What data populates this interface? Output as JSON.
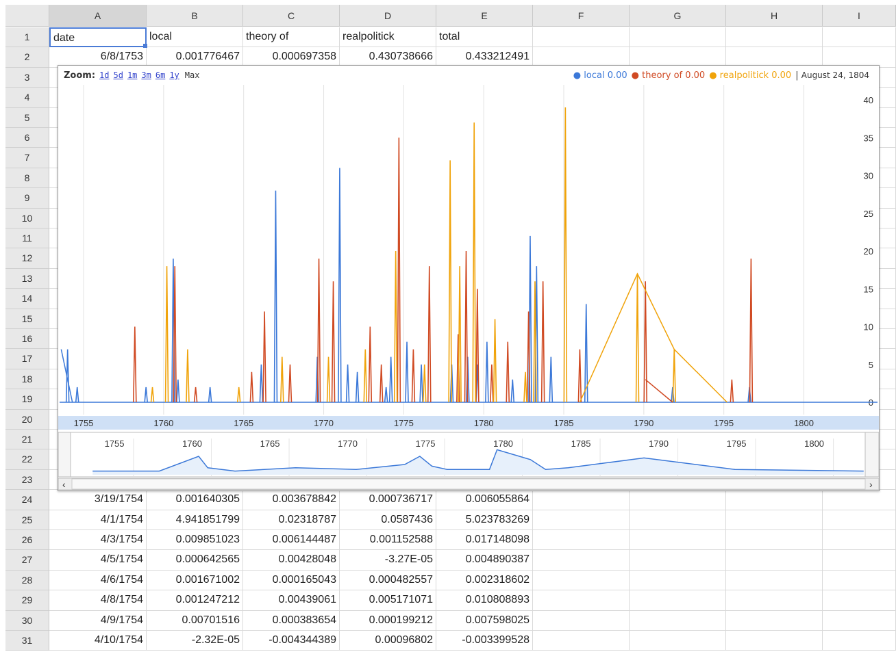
{
  "columns": [
    "A",
    "B",
    "C",
    "D",
    "E",
    "F",
    "G",
    "H",
    "I"
  ],
  "rows": [
    {
      "num": "1",
      "cells": [
        "date",
        "local",
        "theory of",
        "realpolitick",
        "total"
      ]
    },
    {
      "num": "2",
      "cells": [
        "6/8/1753",
        "0.001776467",
        "0.000697358",
        "0.430738666",
        "0.433212491"
      ]
    },
    {
      "num": "3",
      "cells": []
    },
    {
      "num": "4",
      "cells": []
    },
    {
      "num": "5",
      "cells": []
    },
    {
      "num": "6",
      "cells": []
    },
    {
      "num": "7",
      "cells": []
    },
    {
      "num": "8",
      "cells": []
    },
    {
      "num": "9",
      "cells": []
    },
    {
      "num": "10",
      "cells": []
    },
    {
      "num": "11",
      "cells": []
    },
    {
      "num": "12",
      "cells": []
    },
    {
      "num": "13",
      "cells": []
    },
    {
      "num": "14",
      "cells": []
    },
    {
      "num": "15",
      "cells": []
    },
    {
      "num": "16",
      "cells": []
    },
    {
      "num": "17",
      "cells": []
    },
    {
      "num": "18",
      "cells": []
    },
    {
      "num": "19",
      "cells": []
    },
    {
      "num": "20",
      "cells": []
    },
    {
      "num": "21",
      "cells": []
    },
    {
      "num": "22",
      "cells": []
    },
    {
      "num": "23",
      "cells": []
    },
    {
      "num": "24",
      "cells": [
        "3/19/1754",
        "0.001640305",
        "0.003678842",
        "0.000736717",
        "0.006055864"
      ]
    },
    {
      "num": "25",
      "cells": [
        "4/1/1754",
        "4.941851799",
        "0.02318787",
        "0.0587436",
        "5.023783269"
      ]
    },
    {
      "num": "26",
      "cells": [
        "4/3/1754",
        "0.009851023",
        "0.006144487",
        "0.001152588",
        "0.017148098"
      ]
    },
    {
      "num": "27",
      "cells": [
        "4/5/1754",
        "0.000642565",
        "0.00428048",
        "-3.27E-05",
        "0.004890387"
      ]
    },
    {
      "num": "28",
      "cells": [
        "4/6/1754",
        "0.001671002",
        "0.000165043",
        "0.000482557",
        "0.002318602"
      ]
    },
    {
      "num": "29",
      "cells": [
        "4/8/1754",
        "0.001247212",
        "0.00439061",
        "0.005171071",
        "0.010808893"
      ]
    },
    {
      "num": "30",
      "cells": [
        "4/9/1754",
        "0.00701516",
        "0.000383654",
        "0.000199212",
        "0.007598025"
      ]
    },
    {
      "num": "31",
      "cells": [
        "4/10/1754",
        "-2.32E-05",
        "-0.004344389",
        "0.00096802",
        "-0.003399528"
      ]
    }
  ],
  "chart": {
    "zoom_label": "Zoom:",
    "zoom_options": [
      "1d",
      "5d",
      "1m",
      "3m",
      "6m",
      "1y"
    ],
    "zoom_max": "Max",
    "legend": [
      {
        "name": "local",
        "value": "0.00",
        "color": "#3b78d8"
      },
      {
        "name": "theory of",
        "value": "0.00",
        "color": "#d04a23"
      },
      {
        "name": "realpolitick",
        "value": "0.00",
        "color": "#f0a30a"
      }
    ],
    "legend_date": "August 24, 1804",
    "colors": {
      "local": "#3b78d8",
      "theory": "#d04a23",
      "realpolitick": "#f0a30a",
      "axis_band": "#cfe0f6"
    }
  },
  "chart_data": {
    "type": "line",
    "x_ticks": [
      "1755",
      "1760",
      "1765",
      "1770",
      "1775",
      "1780",
      "1785",
      "1790",
      "1795",
      "1800"
    ],
    "y_ticks": [
      "0",
      "5",
      "10",
      "15",
      "20",
      "25",
      "30",
      "35",
      "40"
    ],
    "ylim": [
      0,
      40
    ],
    "xlim": [
      1753.5,
      1804.6
    ],
    "overview_ticks": [
      "1755",
      "1760",
      "1765",
      "1770",
      "1775",
      "1780",
      "1785",
      "1790",
      "1795",
      "1800"
    ],
    "series": [
      {
        "name": "local",
        "spikes": [
          [
            1754.0,
            7
          ],
          [
            1754.6,
            2
          ],
          [
            1758.9,
            2
          ],
          [
            1760.6,
            19
          ],
          [
            1760.9,
            3
          ],
          [
            1762.9,
            2
          ],
          [
            1766.1,
            5
          ],
          [
            1767.0,
            28
          ],
          [
            1769.6,
            6
          ],
          [
            1771.0,
            31
          ],
          [
            1771.5,
            5
          ],
          [
            1772.1,
            4
          ],
          [
            1773.9,
            2
          ],
          [
            1774.2,
            6
          ],
          [
            1775.2,
            8
          ],
          [
            1776.1,
            5
          ],
          [
            1778.0,
            5
          ],
          [
            1779.0,
            6
          ],
          [
            1779.6,
            5
          ],
          [
            1780.2,
            8
          ],
          [
            1781.8,
            3
          ],
          [
            1782.9,
            22
          ],
          [
            1783.3,
            18
          ],
          [
            1784.2,
            6
          ],
          [
            1786.4,
            13
          ],
          [
            1791.8,
            2
          ],
          [
            1796.6,
            2
          ]
        ]
      },
      {
        "name": "theory of",
        "spikes": [
          [
            1758.2,
            10
          ],
          [
            1760.7,
            18
          ],
          [
            1762.0,
            2
          ],
          [
            1765.5,
            4
          ],
          [
            1766.3,
            12
          ],
          [
            1767.9,
            5
          ],
          [
            1769.7,
            19
          ],
          [
            1770.6,
            16
          ],
          [
            1772.9,
            10
          ],
          [
            1773.6,
            5
          ],
          [
            1774.7,
            35
          ],
          [
            1775.6,
            7
          ],
          [
            1776.6,
            18
          ],
          [
            1778.4,
            9
          ],
          [
            1778.9,
            20
          ],
          [
            1779.6,
            15
          ],
          [
            1780.5,
            5
          ],
          [
            1781.5,
            8
          ],
          [
            1782.8,
            12
          ],
          [
            1783.7,
            16
          ],
          [
            1786.0,
            7
          ],
          [
            1790.1,
            16
          ],
          [
            1795.5,
            3
          ],
          [
            1796.7,
            19
          ]
        ]
      },
      {
        "name": "realpolitick",
        "spikes": [
          [
            1759.3,
            2
          ],
          [
            1760.2,
            18
          ],
          [
            1761.5,
            7
          ],
          [
            1764.7,
            2
          ],
          [
            1767.4,
            6
          ],
          [
            1770.3,
            6
          ],
          [
            1772.6,
            7
          ],
          [
            1774.5,
            20
          ],
          [
            1776.3,
            5
          ],
          [
            1777.9,
            32
          ],
          [
            1778.5,
            18
          ],
          [
            1779.4,
            37
          ],
          [
            1780.7,
            11
          ],
          [
            1782.6,
            4
          ],
          [
            1783.2,
            16
          ],
          [
            1785.1,
            39
          ],
          [
            1789.6,
            17
          ],
          [
            1791.9,
            7
          ]
        ]
      }
    ]
  }
}
